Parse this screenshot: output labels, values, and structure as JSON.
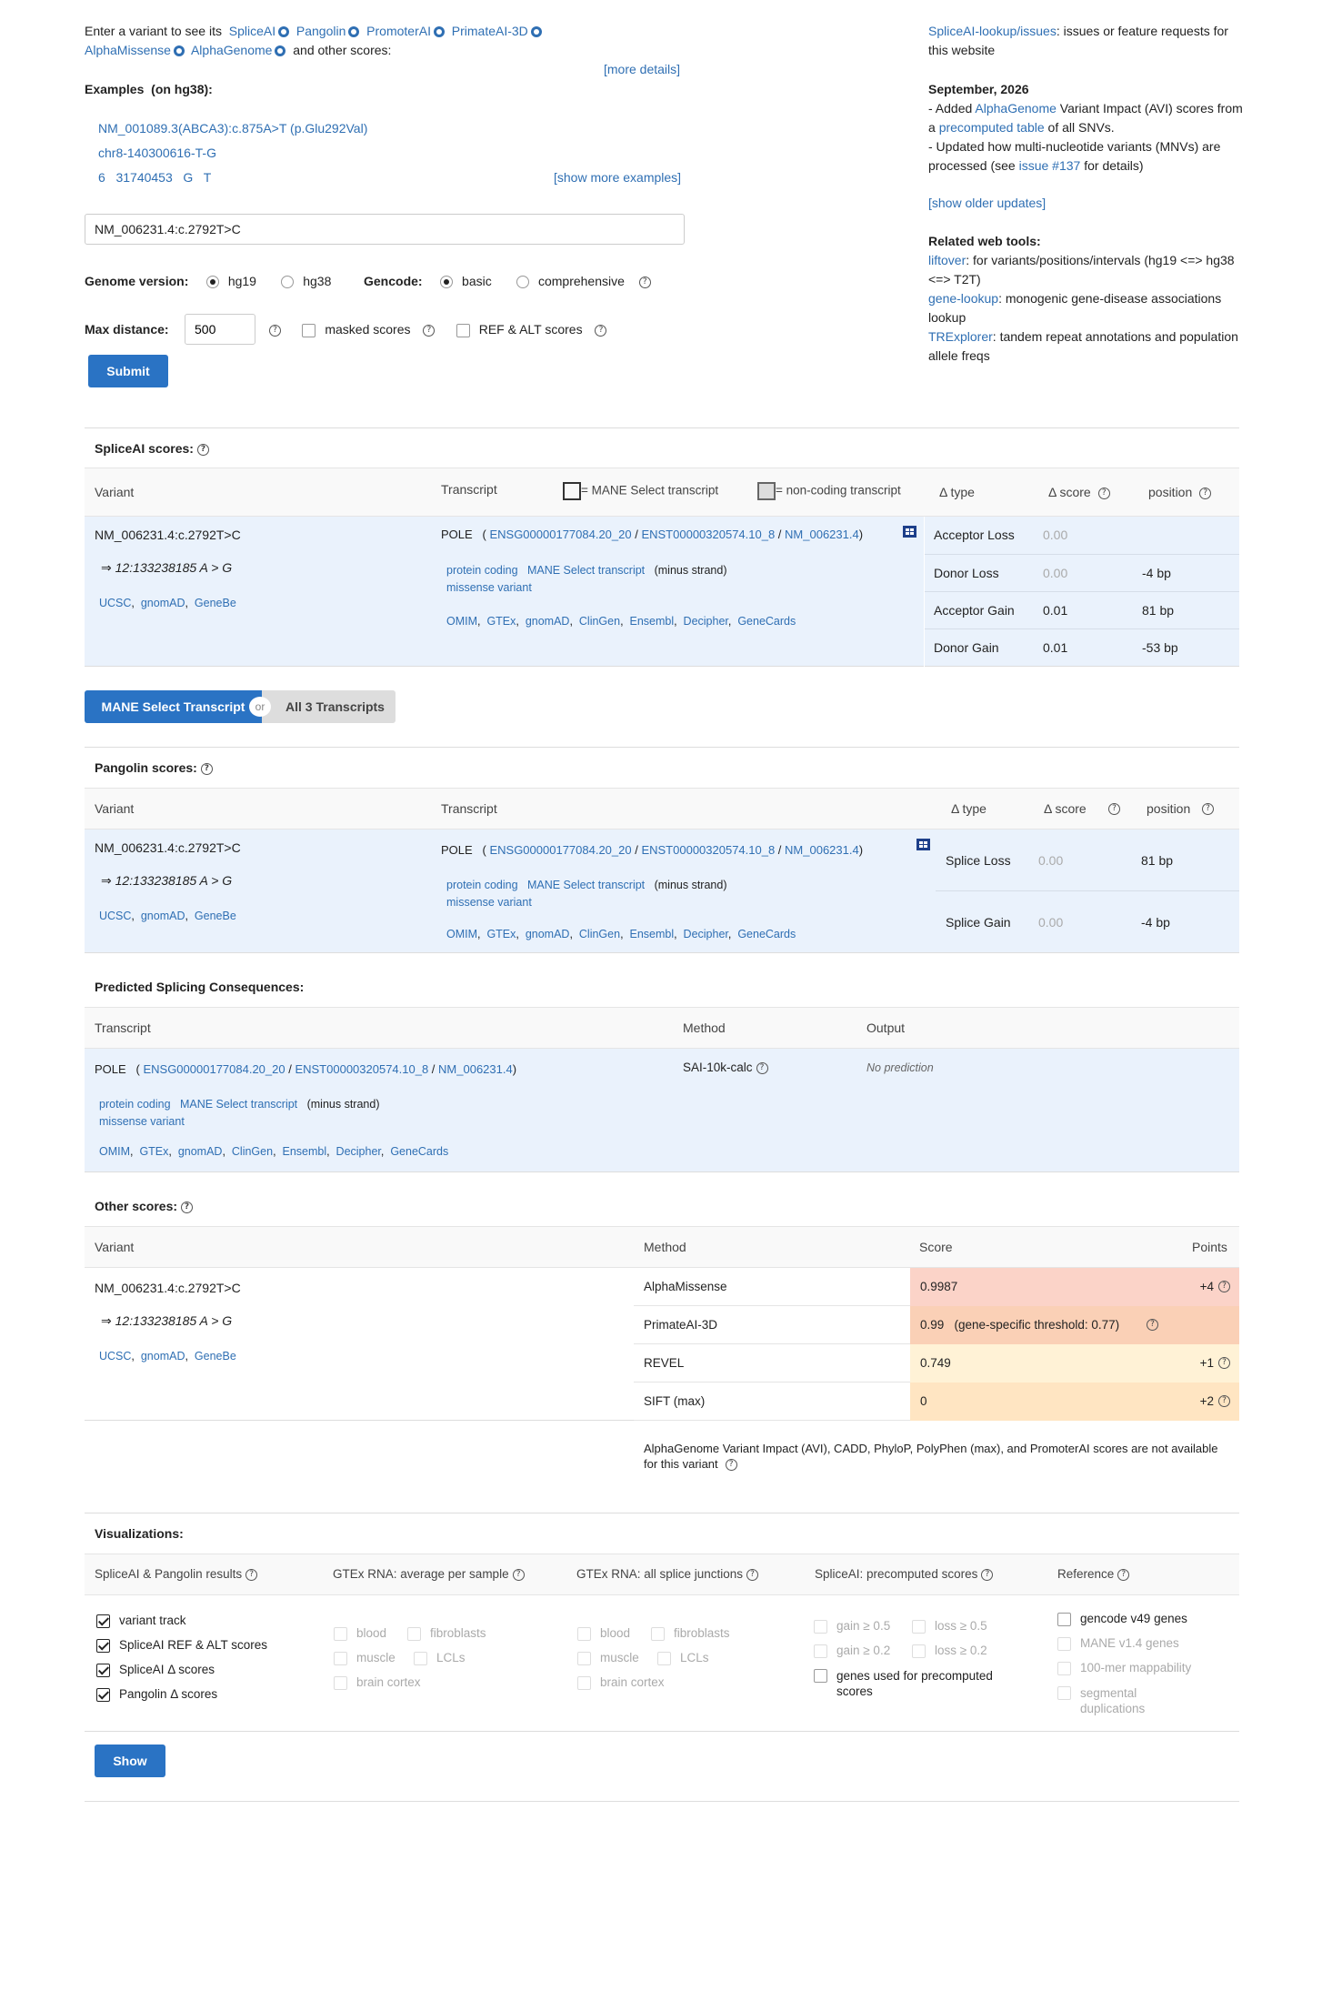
{
  "intro": {
    "prefix": "Enter a variant to see its",
    "tools": [
      "SpliceAI",
      "Pangolin",
      "PromoterAI",
      "PrimateAI-3D",
      "AlphaMissense",
      "AlphaGenome"
    ],
    "suffix": "and other scores:",
    "more_details": "[more details]"
  },
  "examples": {
    "label": "Examples",
    "build": "(on hg38):",
    "items": [
      "NM_001089.3(ABCA3):c.875A>T (p.Glu292Val)",
      "chr8-140300616-T-G",
      "6   31740453   G   T"
    ],
    "show_more": "[show more examples]"
  },
  "search": {
    "value": "NM_006231.4:c.2792T>C"
  },
  "genome": {
    "label": "Genome version:",
    "options": [
      "hg19",
      "hg38"
    ],
    "selected": "hg19"
  },
  "gencode": {
    "label": "Gencode:",
    "options": [
      "basic",
      "comprehensive"
    ],
    "selected": "basic"
  },
  "maxdist": {
    "label": "Max distance:",
    "value": "500",
    "masked": "masked scores",
    "refalt": "REF & ALT scores"
  },
  "submit": "Submit",
  "news": {
    "issues_link": "SpliceAI-lookup/issues",
    "issues_text": ": issues or feature requests for this website",
    "date": "September, 2026",
    "l1a": "- Added ",
    "l1b": "AlphaGenome",
    "l1c": " Variant Impact (AVI) scores from a ",
    "l1d": "precomputed table",
    "l1e": " of all SNVs.",
    "l2a": "- Updated how multi-nucleotide variants (MNVs) are processed (see ",
    "l2b": "issue #137",
    "l2c": " for details)",
    "older": "[show older updates]",
    "related": "Related web tools:",
    "t1": "liftover",
    "t1d": ": for variants/positions/intervals (hg19 <=> hg38 <=> T2T)",
    "t2": "gene-lookup",
    "t2d": ": monogenic gene-disease associations lookup",
    "t3": "TRExplorer",
    "t3d": ": tandem repeat annotations and population allele freqs"
  },
  "variant": {
    "name": "NM_006231.4:c.2792T>C",
    "coord": "⇒ 12:133238185 A > G",
    "links": [
      "UCSC",
      "gnomAD",
      "GeneBe"
    ]
  },
  "transcript": {
    "gene": "POLE",
    "ids": [
      "ENSG00000177084.20_20",
      "ENST00000320574.10_8",
      "NM_006231.4"
    ],
    "type": "protein coding",
    "mane": "MANE Select transcript",
    "strand": "(minus strand)",
    "consequence": "missense variant",
    "dbs": [
      "OMIM",
      "GTEx",
      "gnomAD",
      "ClinGen",
      "Ensembl",
      "Decipher",
      "GeneCards"
    ]
  },
  "spliceai": {
    "title": "SpliceAI scores:",
    "headers": {
      "variant": "Variant",
      "transcript": "Transcript",
      "mane_legend": "= MANE Select transcript",
      "noncoding_legend": "= non-coding transcript",
      "dtype": "Δ type",
      "dscore": "Δ score",
      "position": "position"
    },
    "rows": [
      {
        "type": "Acceptor Loss",
        "score": "0.00",
        "pos": ""
      },
      {
        "type": "Donor Loss",
        "score": "0.00",
        "pos": "-4 bp"
      },
      {
        "type": "Acceptor Gain",
        "score": "0.01",
        "pos": "81 bp"
      },
      {
        "type": "Donor Gain",
        "score": "0.01",
        "pos": "-53 bp"
      }
    ]
  },
  "toggle": {
    "mane": "MANE Select Transcript",
    "or": "or",
    "all": "All 3 Transcripts"
  },
  "pangolin": {
    "title": "Pangolin scores:",
    "rows": [
      {
        "type": "Splice Loss",
        "score": "0.00",
        "pos": "81 bp"
      },
      {
        "type": "Splice Gain",
        "score": "0.00",
        "pos": "-4 bp"
      }
    ]
  },
  "consequences": {
    "title": "Predicted Splicing Consequences:",
    "headers": {
      "transcript": "Transcript",
      "method": "Method",
      "output": "Output"
    },
    "method": "SAI-10k-calc",
    "output": "No prediction"
  },
  "other": {
    "title": "Other scores:",
    "headers": {
      "variant": "Variant",
      "method": "Method",
      "score": "Score",
      "points": "Points"
    },
    "rows": [
      {
        "method": "AlphaMissense",
        "score": "0.9987",
        "points": "+4",
        "color": "#fbd3c8"
      },
      {
        "method": "PrimateAI-3D",
        "score": "0.99   (gene-specific threshold: 0.77)",
        "points": "",
        "color": "#fad0b6"
      },
      {
        "method": "REVEL",
        "score": "0.749",
        "points": "+1",
        "color": "#fff2d6"
      },
      {
        "method": "SIFT (max)",
        "score": "0",
        "points": "+2",
        "color": "#ffe5c2"
      }
    ],
    "na_note": "AlphaGenome Variant Impact (AVI),  CADD,  PhyloP,  PolyPhen (max),  and PromoterAI scores are not available for this variant"
  },
  "viz": {
    "title": "Visualizations:",
    "col1": {
      "header": "SpliceAI & Pangolin results",
      "items": [
        "variant track",
        "SpliceAI REF & ALT scores",
        "SpliceAI Δ  scores",
        "Pangolin Δ  scores"
      ]
    },
    "col2": {
      "header": "GTEx RNA: average per sample",
      "items": [
        "blood",
        "fibroblasts",
        "muscle",
        "LCLs",
        "brain cortex"
      ]
    },
    "col3": {
      "header": "GTEx RNA: all splice junctions",
      "items": [
        "blood",
        "fibroblasts",
        "muscle",
        "LCLs",
        "brain cortex"
      ]
    },
    "col4": {
      "header": "SpliceAI: precomputed scores",
      "items": [
        "gain ≥ 0.5",
        "loss ≥ 0.5",
        "gain ≥ 0.2",
        "loss ≥ 0.2",
        "genes used for precomputed scores"
      ]
    },
    "col5": {
      "header": "Reference",
      "items": [
        "gencode v49 genes",
        "MANE v1.4 genes",
        "100-mer mappability",
        "segmental duplications"
      ]
    },
    "show": "Show"
  }
}
